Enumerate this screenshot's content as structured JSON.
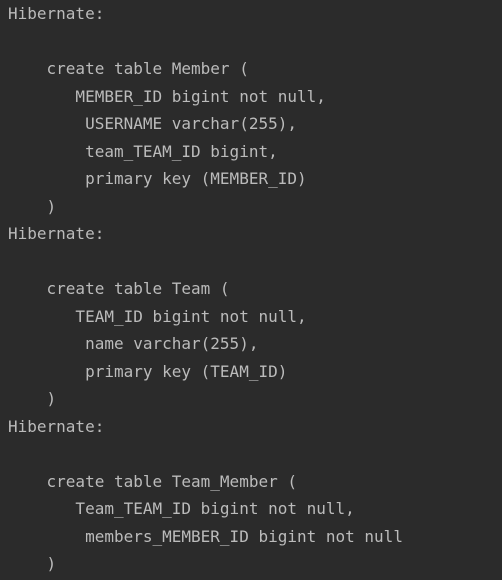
{
  "console": {
    "text_color": "#bbbbbb",
    "background_color": "#2b2b2b",
    "lines": [
      "Hibernate: ",
      "",
      "    create table Member (",
      "       MEMBER_ID bigint not null,",
      "        USERNAME varchar(255),",
      "        team_TEAM_ID bigint,",
      "        primary key (MEMBER_ID)",
      "    )",
      "Hibernate: ",
      "",
      "    create table Team (",
      "       TEAM_ID bigint not null,",
      "        name varchar(255),",
      "        primary key (TEAM_ID)",
      "    )",
      "Hibernate: ",
      "",
      "    create table Team_Member (",
      "       Team_TEAM_ID bigint not null,",
      "        members_MEMBER_ID bigint not null",
      "    )"
    ]
  }
}
